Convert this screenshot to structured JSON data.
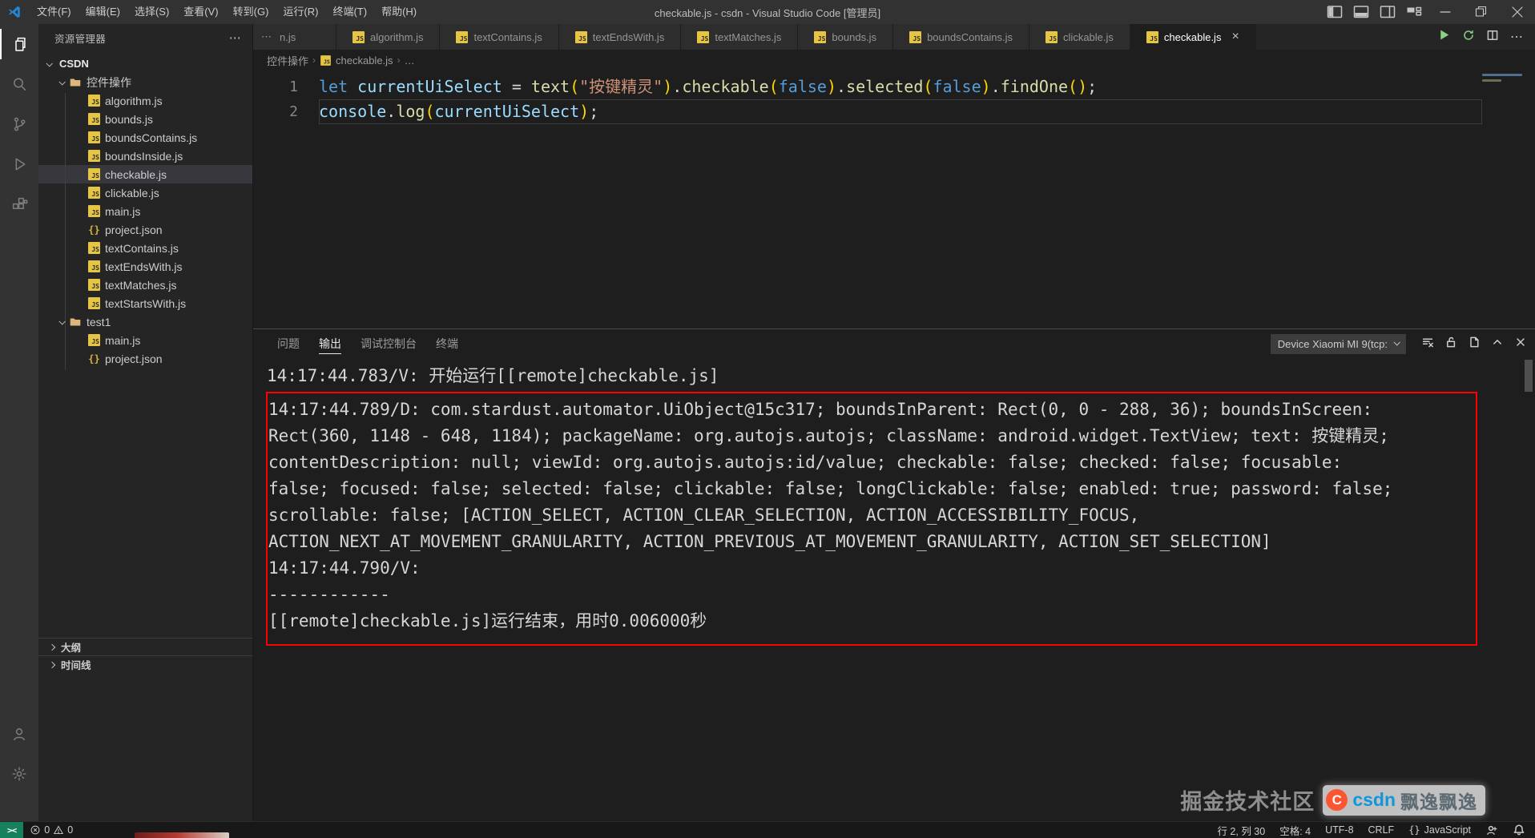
{
  "titlebar": {
    "title": "checkable.js - csdn - Visual Studio Code [管理员]",
    "menus": [
      "文件(F)",
      "编辑(E)",
      "选择(S)",
      "查看(V)",
      "转到(G)",
      "运行(R)",
      "终端(T)",
      "帮助(H)"
    ],
    "layout_controls": [
      "layout-sidebar",
      "layout-panel",
      "layout-sidebar-right",
      "layout-customize"
    ],
    "window_buttons": [
      "minimize",
      "restore",
      "close-window"
    ]
  },
  "activitybar": {
    "top": [
      {
        "name": "explorer",
        "active": true
      },
      {
        "name": "search"
      },
      {
        "name": "source-control"
      },
      {
        "name": "run-debug"
      },
      {
        "name": "extensions"
      }
    ],
    "bottom": [
      {
        "name": "account"
      },
      {
        "name": "settings"
      }
    ]
  },
  "sidebar": {
    "header": "资源管理器",
    "tree": [
      {
        "label": "CSDN",
        "type": "root",
        "indent": 0,
        "chevron": "down"
      },
      {
        "label": "控件操作",
        "type": "folder",
        "indent": 1,
        "chevron": "down"
      },
      {
        "label": "algorithm.js",
        "type": "js",
        "indent": 2
      },
      {
        "label": "bounds.js",
        "type": "js",
        "indent": 2
      },
      {
        "label": "boundsContains.js",
        "type": "js",
        "indent": 2
      },
      {
        "label": "boundsInside.js",
        "type": "js",
        "indent": 2
      },
      {
        "label": "checkable.js",
        "type": "js",
        "indent": 2,
        "selected": true
      },
      {
        "label": "clickable.js",
        "type": "js",
        "indent": 2
      },
      {
        "label": "main.js",
        "type": "js",
        "indent": 2
      },
      {
        "label": "project.json",
        "type": "json",
        "indent": 2
      },
      {
        "label": "textContains.js",
        "type": "js",
        "indent": 2
      },
      {
        "label": "textEndsWith.js",
        "type": "js",
        "indent": 2
      },
      {
        "label": "textMatches.js",
        "type": "js",
        "indent": 2
      },
      {
        "label": "textStartsWith.js",
        "type": "js",
        "indent": 2
      },
      {
        "label": "test1",
        "type": "folder",
        "indent": 1,
        "chevron": "down"
      },
      {
        "label": "main.js",
        "type": "js",
        "indent": 2
      },
      {
        "label": "project.json",
        "type": "json",
        "indent": 2
      }
    ],
    "bottom_sections": [
      "大纲",
      "时间线"
    ]
  },
  "tabs": {
    "items": [
      {
        "label": "n.js",
        "partial": true
      },
      {
        "label": "algorithm.js"
      },
      {
        "label": "textContains.js"
      },
      {
        "label": "textEndsWith.js"
      },
      {
        "label": "textMatches.js"
      },
      {
        "label": "bounds.js"
      },
      {
        "label": "boundsContains.js"
      },
      {
        "label": "clickable.js"
      },
      {
        "label": "checkable.js",
        "active": true
      }
    ],
    "actions": [
      "run",
      "restart",
      "split-editor",
      "more"
    ]
  },
  "breadcrumb": {
    "items": [
      "控件操作",
      "checkable.js",
      "…"
    ]
  },
  "editor": {
    "lines": [
      {
        "num": "1",
        "tokens": [
          [
            "let ",
            "kw"
          ],
          [
            "currentUiSelect",
            "var"
          ],
          [
            " = ",
            "pun"
          ],
          [
            "text",
            "fn"
          ],
          [
            "(",
            "br"
          ],
          [
            "\"按键精灵\"",
            "str"
          ],
          [
            ")",
            "br"
          ],
          [
            ".",
            "pun"
          ],
          [
            "checkable",
            "fn"
          ],
          [
            "(",
            "br"
          ],
          [
            "false",
            "kw"
          ],
          [
            ")",
            "br"
          ],
          [
            ".",
            "pun"
          ],
          [
            "selected",
            "fn"
          ],
          [
            "(",
            "br"
          ],
          [
            "false",
            "kw"
          ],
          [
            ")",
            "br"
          ],
          [
            ".",
            "pun"
          ],
          [
            "findOne",
            "fn"
          ],
          [
            "()",
            "br"
          ],
          [
            ";",
            "pun"
          ]
        ]
      },
      {
        "num": "2",
        "current": true,
        "tokens": [
          [
            "console",
            "var"
          ],
          [
            ".",
            "pun"
          ],
          [
            "log",
            "fn"
          ],
          [
            "(",
            "br"
          ],
          [
            "currentUiSelect",
            "var"
          ],
          [
            ")",
            "br"
          ],
          [
            ";",
            "pun"
          ]
        ]
      }
    ]
  },
  "panel": {
    "tabs": [
      {
        "label": "问题"
      },
      {
        "label": "输出",
        "active": true
      },
      {
        "label": "调试控制台"
      },
      {
        "label": "终端"
      }
    ],
    "device_dropdown": "Device Xiaomi MI 9(tcp:",
    "actions": [
      "clear-output",
      "unlock",
      "open-editor",
      "chevron-up",
      "close"
    ],
    "output_intro": "14:17:44.783/V: 开始运行[[remote]checkable.js]",
    "output_boxed": [
      "14:17:44.789/D: com.stardust.automator.UiObject@15c317; boundsInParent: Rect(0, 0 - 288, 36); boundsInScreen:",
      "Rect(360, 1148 - 648, 1184); packageName: org.autojs.autojs; className: android.widget.TextView; text: 按键精灵;",
      "contentDescription: null; viewId: org.autojs.autojs:id/value; checkable: false; checked: false; focusable:",
      "false; focused: false; selected: false; clickable: false; longClickable: false; enabled: true; password: false;",
      "scrollable: false; [ACTION_SELECT, ACTION_CLEAR_SELECTION, ACTION_ACCESSIBILITY_FOCUS,",
      "ACTION_NEXT_AT_MOVEMENT_GRANULARITY, ACTION_PREVIOUS_AT_MOVEMENT_GRANULARITY, ACTION_SET_SELECTION]",
      "14:17:44.790/V: ",
      "------------",
      "[[remote]checkable.js]运行结束，用时0.006000秒"
    ],
    "box_color": "#ff0000"
  },
  "statusbar": {
    "remote": "><",
    "errors": "0",
    "warnings": "0",
    "items": [
      {
        "label": "行 2, 列 30"
      },
      {
        "label": "空格: 4"
      },
      {
        "label": "UTF-8"
      },
      {
        "label": "CRLF"
      },
      {
        "label": "JavaScript",
        "icon": "braces"
      }
    ],
    "right_icons": [
      "feedback",
      "bell"
    ]
  },
  "watermark": {
    "community": "掘金技术社区",
    "logo_letter": "C",
    "handle_name": "csdn",
    "handle_user": "飘逸飘逸"
  },
  "icons": {
    "more_horizontal": "⋯",
    "close_glyph": "×",
    "js_badge": "JS",
    "json_badge": "{}",
    "braces_glyph": "{}"
  },
  "colors": {
    "accent_blue": "#569cd6",
    "variable": "#9cdcfe",
    "function": "#dcdcaa",
    "string": "#ce9178",
    "bracket": "#ffd700",
    "annotation_red": "#ff0000",
    "js_icon_yellow": "#e7c544",
    "remote_green": "#16825d",
    "csdn_orange": "#fc5531",
    "csdn_blue": "#1296db"
  }
}
